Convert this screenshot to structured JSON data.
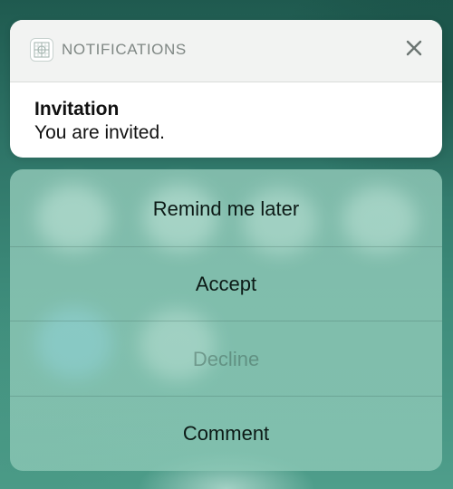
{
  "notification": {
    "app_name": "NOTIFICATIONS",
    "app_icon": "app-grid-icon",
    "close_icon": "close-icon",
    "title": "Invitation",
    "body": "You are invited."
  },
  "actions": [
    {
      "label": "Remind me later",
      "enabled": true
    },
    {
      "label": "Accept",
      "enabled": true
    },
    {
      "label": "Decline",
      "enabled": false
    },
    {
      "label": "Comment",
      "enabled": true
    }
  ],
  "colors": {
    "background": "#2e7467",
    "card": "#ffffff",
    "header": "#f2f3f2",
    "action_sheet": "#96cdbc"
  }
}
